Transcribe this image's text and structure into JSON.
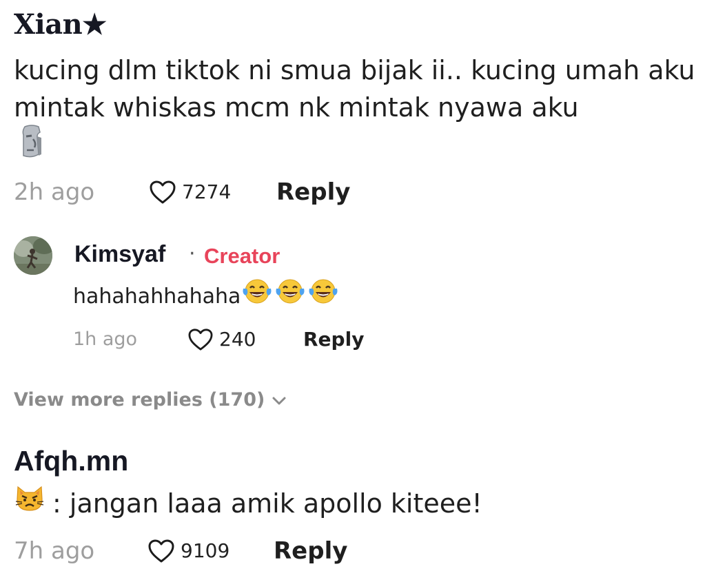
{
  "comments": [
    {
      "username": "Xian★",
      "text": "kucing dlm tiktok ni smua bijak ii.. kucing umah aku mintak whiskas mcm nk mintak nyawa aku",
      "emoji_icon": "moai-emoji-icon",
      "time": "2h ago",
      "likes": "7274",
      "reply_label": "Reply",
      "replies": [
        {
          "username": "Kimsyaf",
          "separator": "·",
          "badge": "Creator",
          "text": "hahahahhahaha",
          "emoji_icons": [
            "laughing-tears-emoji-icon",
            "laughing-tears-emoji-icon",
            "laughing-tears-emoji-icon"
          ],
          "time": "1h ago",
          "likes": "240",
          "reply_label": "Reply"
        }
      ],
      "view_more_label": "View more replies (170)"
    },
    {
      "username": "Afqh.mn",
      "emoji_icon": "pouting-cat-emoji-icon",
      "text": ": jangan laaa amik apollo kiteee!",
      "time": "7h ago",
      "likes": "9109",
      "reply_label": "Reply"
    }
  ],
  "colors": {
    "creator_badge": "#e8445a",
    "meta_gray": "#9e9e9e",
    "text": "#161823"
  }
}
